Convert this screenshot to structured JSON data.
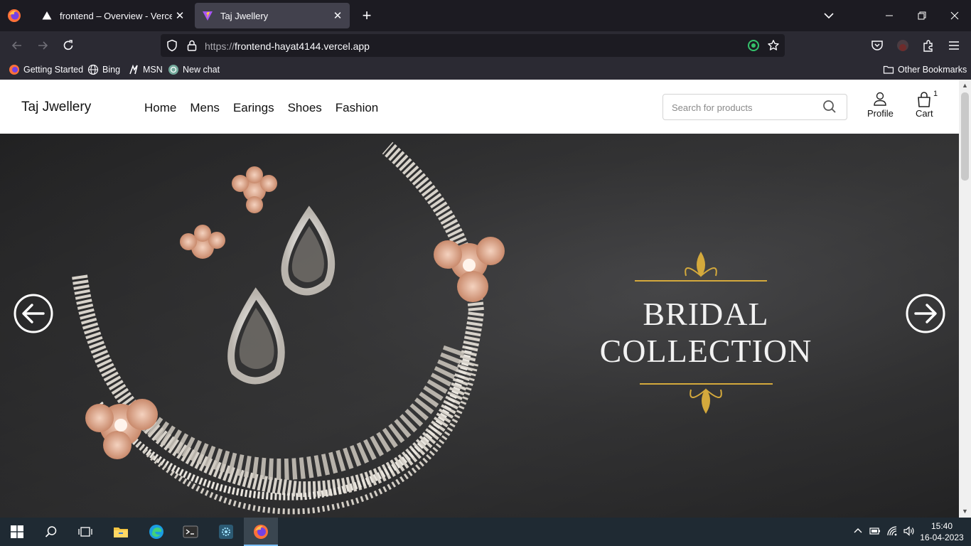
{
  "browser": {
    "tabs": [
      {
        "title": "frontend – Overview - Vercel",
        "active": false
      },
      {
        "title": "Taj Jwellery",
        "active": true
      }
    ],
    "url_scheme": "https://",
    "url_host": "frontend-hayat4144.vercel.app",
    "bookmarks": [
      "Getting Started",
      "Bing",
      "MSN",
      "New chat"
    ],
    "other_bookmarks": "Other Bookmarks"
  },
  "site": {
    "brand": "Taj Jwellery",
    "menu": [
      "Home",
      "Mens",
      "Earings",
      "Shoes",
      "Fashion"
    ],
    "search_placeholder": "Search for products",
    "profile_label": "Profile",
    "cart_label": "Cart",
    "cart_count": "1"
  },
  "hero": {
    "line1": "BRIDAL",
    "line2": "COLLECTION",
    "accent_color": "#d4a93c"
  },
  "taskbar": {
    "time": "15:40",
    "date": "16-04-2023"
  }
}
